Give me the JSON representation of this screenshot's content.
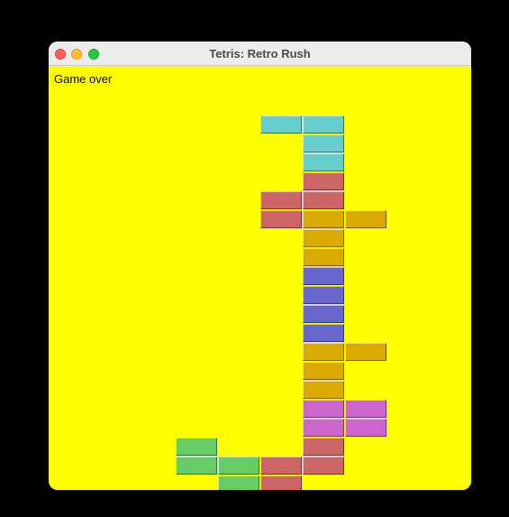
{
  "window": {
    "title": "Tetris: Retro Rush"
  },
  "board": {
    "status": "Game over",
    "background": "#ffff00"
  },
  "pieces": {
    "cyan": "#66cccc",
    "red": "#cc6666",
    "orange": "#daaa00",
    "blue": "#6666cc",
    "magenta": "#cc66cc",
    "green": "#66cc66"
  },
  "cells": [
    {
      "col": 5,
      "row": 0,
      "piece": "cyan"
    },
    {
      "col": 6,
      "row": 0,
      "piece": "cyan"
    },
    {
      "col": 6,
      "row": 1,
      "piece": "cyan"
    },
    {
      "col": 6,
      "row": 2,
      "piece": "cyan"
    },
    {
      "col": 6,
      "row": 3,
      "piece": "red"
    },
    {
      "col": 5,
      "row": 4,
      "piece": "red"
    },
    {
      "col": 6,
      "row": 4,
      "piece": "red"
    },
    {
      "col": 5,
      "row": 5,
      "piece": "red"
    },
    {
      "col": 6,
      "row": 5,
      "piece": "orange"
    },
    {
      "col": 7,
      "row": 5,
      "piece": "orange"
    },
    {
      "col": 6,
      "row": 6,
      "piece": "orange"
    },
    {
      "col": 6,
      "row": 7,
      "piece": "orange"
    },
    {
      "col": 6,
      "row": 8,
      "piece": "blue"
    },
    {
      "col": 6,
      "row": 9,
      "piece": "blue"
    },
    {
      "col": 6,
      "row": 10,
      "piece": "blue"
    },
    {
      "col": 6,
      "row": 11,
      "piece": "blue"
    },
    {
      "col": 6,
      "row": 12,
      "piece": "orange"
    },
    {
      "col": 7,
      "row": 12,
      "piece": "orange"
    },
    {
      "col": 6,
      "row": 13,
      "piece": "orange"
    },
    {
      "col": 6,
      "row": 14,
      "piece": "orange"
    },
    {
      "col": 6,
      "row": 15,
      "piece": "magenta"
    },
    {
      "col": 7,
      "row": 15,
      "piece": "magenta"
    },
    {
      "col": 6,
      "row": 16,
      "piece": "magenta"
    },
    {
      "col": 7,
      "row": 16,
      "piece": "magenta"
    },
    {
      "col": 3,
      "row": 17,
      "piece": "green"
    },
    {
      "col": 6,
      "row": 17,
      "piece": "red"
    },
    {
      "col": 3,
      "row": 18,
      "piece": "green"
    },
    {
      "col": 4,
      "row": 18,
      "piece": "green"
    },
    {
      "col": 5,
      "row": 18,
      "piece": "red"
    },
    {
      "col": 6,
      "row": 18,
      "piece": "red"
    },
    {
      "col": 4,
      "row": 19,
      "piece": "green"
    },
    {
      "col": 5,
      "row": 19,
      "piece": "red"
    }
  ]
}
